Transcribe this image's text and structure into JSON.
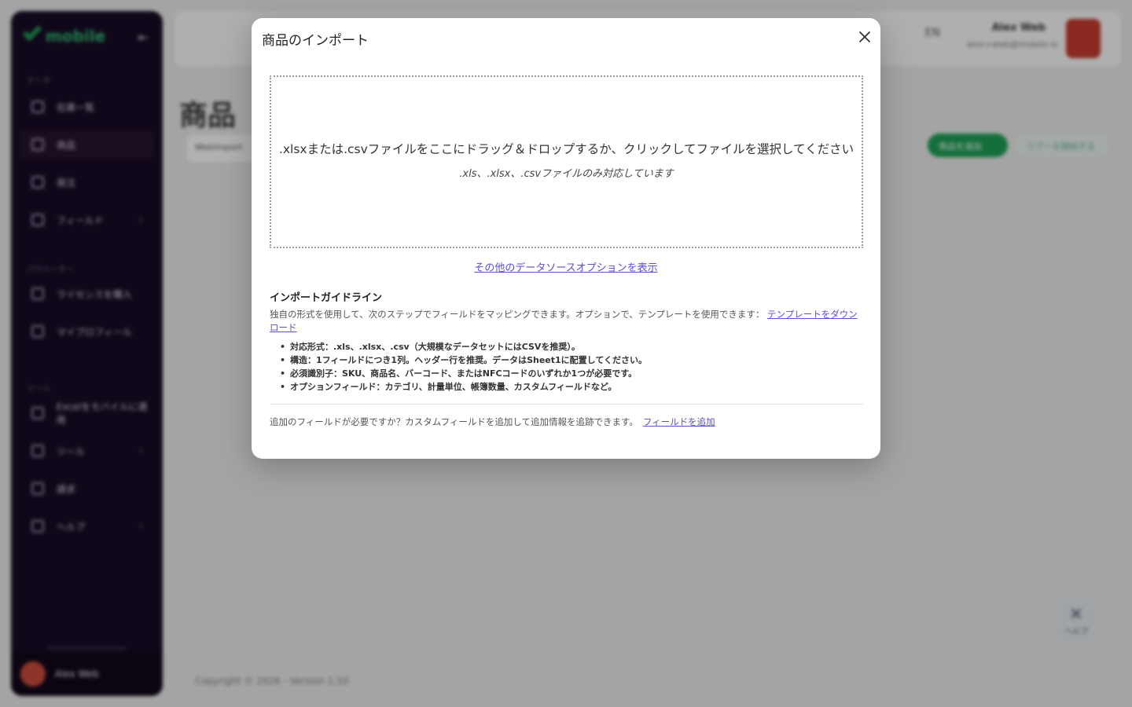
{
  "background": {
    "sidebar": {
      "logo_text": "mobile",
      "sections": [
        "データ",
        "パラメーター",
        "ツール"
      ],
      "items": [
        {
          "label": "在庫一覧",
          "chevron": false
        },
        {
          "label": "商品",
          "chevron": false
        },
        {
          "label": "発注",
          "chevron": false
        },
        {
          "label": "フィールド",
          "chevron": true
        },
        {
          "label": "ライセンスを購入",
          "chevron": false
        },
        {
          "label": "マイプロフィール",
          "chevron": false
        },
        {
          "label": "Excelをモバイルに適用",
          "chevron": false
        },
        {
          "label": "ツール",
          "chevron": true
        },
        {
          "label": "請求",
          "chevron": false
        },
        {
          "label": "ヘルプ",
          "chevron": true
        }
      ],
      "user_name": "Alex Web"
    },
    "topbar": {
      "lang": "EN",
      "user_name": "Alex Web",
      "user_email": "alex+web@mobile.io"
    },
    "page_title": "商品",
    "search_value": "Webimport",
    "add_button": "商品を追加",
    "tour_button": "ツアーを開始する",
    "help_fab": "ヘルプ",
    "copyright": "Copyright © 2026 - Version 1.10"
  },
  "modal": {
    "title": "商品のインポート",
    "dropzone_main": ".xlsxまたは.csvファイルをここにドラッグ＆ドロップするか、クリックしてファイルを選択してください",
    "dropzone_sub": ".xls、.xlsx、.csvファイルのみ対応しています",
    "more_sources_link": "その他のデータソースオプションを表示",
    "guide_title": "インポートガイドライン",
    "guide_desc": "独自の形式を使用して、次のステップでフィールドをマッピングできます。オプションで、テンプレートを使用できます：",
    "template_link": "テンプレートをダウンロード",
    "guide_items": [
      "対応形式：.xls、.xlsx、.csv（大規模なデータセットにはCSVを推奨）。",
      "構造：1フィールドにつき1列。ヘッダー行を推奨。データはSheet1に配置してください。",
      "必須識別子：SKU、商品名、バーコード、またはNFCコードのいずれか1つが必要です。",
      "オプションフィールド：カテゴリ、計量単位、帳簿数量、カスタムフィールドなど。"
    ],
    "footer_note": "追加のフィールドが必要ですか？カスタムフィールドを追加して追加情報を追跡できます。",
    "add_field_link": "フィールドを追加"
  }
}
